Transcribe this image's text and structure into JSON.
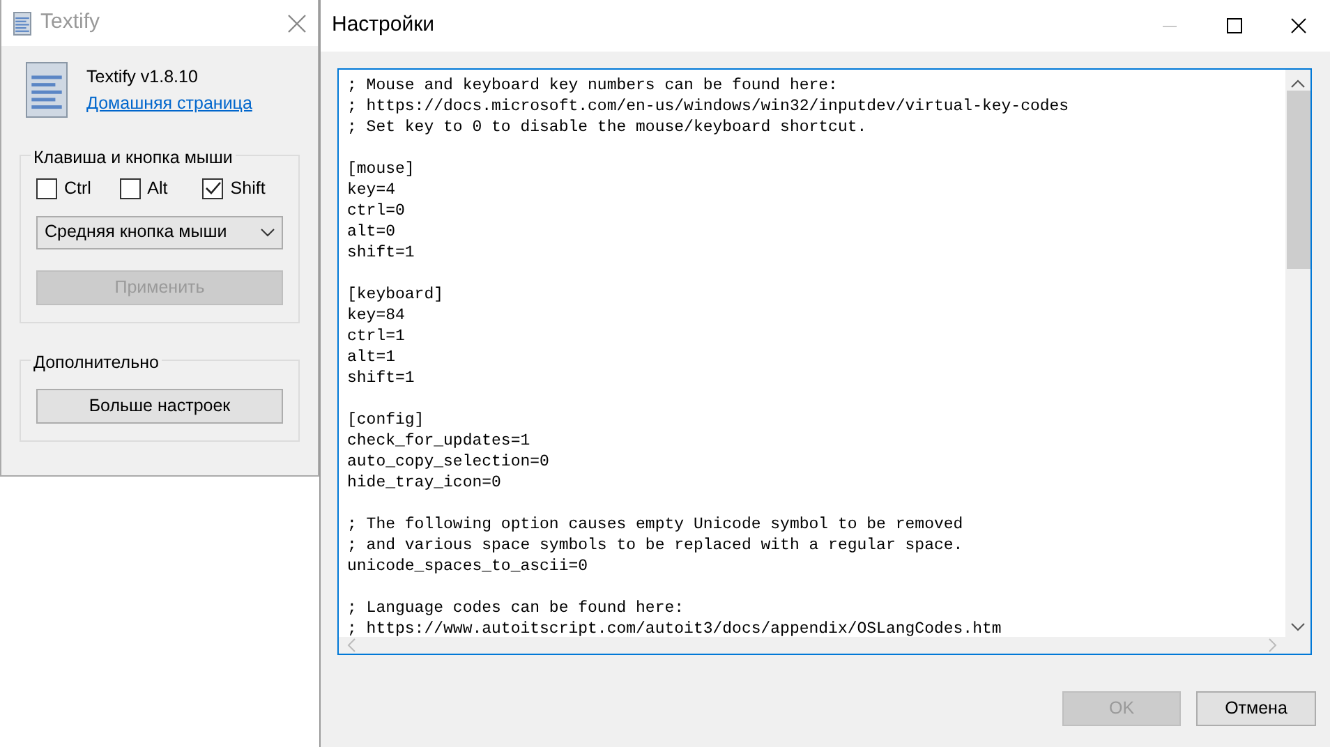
{
  "about_window": {
    "title": "Textify",
    "app_name": "Textify v1.8.10",
    "homepage_link": "Домашняя страница",
    "shortcut_group": {
      "title": "Клавиша и кнопка мыши",
      "modifiers": [
        {
          "label": "Ctrl",
          "checked": false
        },
        {
          "label": "Alt",
          "checked": false
        },
        {
          "label": "Shift",
          "checked": true
        }
      ],
      "mouse_button": {
        "value": "Средняя кнопка мыши"
      },
      "apply_button": {
        "label": "Применить",
        "disabled": true
      }
    },
    "advanced_group": {
      "title": "Дополнительно",
      "more_settings_button": {
        "label": "Больше настроек",
        "disabled": false
      }
    }
  },
  "settings_window": {
    "title": "Настройки",
    "minimize_disabled": true,
    "editor": {
      "blocks": [
        [
          "; Mouse and keyboard key numbers can be found here:",
          "; https://docs.microsoft.com/en-us/windows/win32/inputdev/virtual-key-codes",
          "; Set key to 0 to disable the mouse/keyboard shortcut."
        ],
        [
          "[mouse]",
          "key=4",
          "ctrl=0",
          "alt=0",
          "shift=1"
        ],
        [
          "[keyboard]",
          "key=84",
          "ctrl=1",
          "alt=1",
          "shift=1"
        ],
        [
          "[config]",
          "check_for_updates=1",
          "auto_copy_selection=0",
          "hide_tray_icon=0"
        ],
        [
          "; The following option causes empty Unicode symbol to be removed",
          "; and various space symbols to be replaced with a regular space.",
          "unicode_spaces_to_ascii=0"
        ],
        [
          "; Language codes can be found here:",
          "; https://www.autoitscript.com/autoit3/docs/appendix/OSLangCodes.htm"
        ]
      ]
    },
    "buttons": [
      {
        "label": "OK",
        "disabled": true
      },
      {
        "label": "Отмена",
        "disabled": false
      }
    ]
  }
}
